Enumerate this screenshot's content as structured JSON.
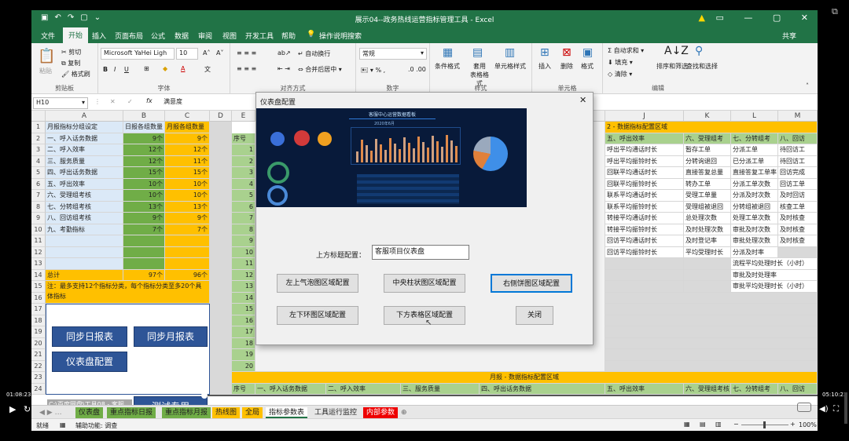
{
  "window": {
    "title": "展示04--政务热线运营指标管理工具 - Excel",
    "share": "共享"
  },
  "menu": {
    "items": [
      "文件",
      "开始",
      "插入",
      "页面布局",
      "公式",
      "数据",
      "审阅",
      "视图",
      "开发工具",
      "帮助"
    ],
    "active": "开始",
    "search": "操作说明搜索"
  },
  "ribbon": {
    "clipboard": {
      "label": "剪贴板",
      "paste": "粘贴",
      "cut": "剪切",
      "copy": "复制",
      "format_painter": "格式刷"
    },
    "font": {
      "label": "字体",
      "family": "Microsoft YaHei Ligh",
      "size": "10",
      "wen": "文"
    },
    "alignment": {
      "label": "对齐方式",
      "wrap": "自动换行",
      "merge": "合并后居中"
    },
    "number": {
      "label": "数字",
      "format": "常规"
    },
    "styles": {
      "label": "样式",
      "conditional": "条件格式",
      "table": "套用\n表格格式",
      "cell_styles": "单元格样式"
    },
    "cells": {
      "label": "单元格",
      "insert": "插入",
      "delete": "删除",
      "format": "格式"
    },
    "editing": {
      "label": "编辑",
      "autosum": "自动求和",
      "fill": "填充",
      "clear": "清除",
      "sort": "排序和筛选",
      "find": "查找和选择"
    }
  },
  "formula_bar": {
    "name_box": "H10",
    "content": "满意度"
  },
  "columns": [
    "A",
    "B",
    "C",
    "D",
    "E",
    "J",
    "K",
    "L",
    "M"
  ],
  "left_table": {
    "headers": [
      "月报指标分组设定",
      "日报各组数量",
      "月报各组数量"
    ],
    "rows": [
      [
        "一、呼入话务数据",
        "9个",
        "9个"
      ],
      [
        "二、呼入效率",
        "12个",
        "12个"
      ],
      [
        "三、服务质量",
        "12个",
        "11个"
      ],
      [
        "四、呼出话务数据",
        "15个",
        "15个"
      ],
      [
        "五、呼出效率",
        "10个",
        "10个"
      ],
      [
        "六、受理组考核",
        "10个",
        "10个"
      ],
      [
        "七、分转组考核",
        "13个",
        "13个"
      ],
      [
        "八、回访组考核",
        "9个",
        "9个"
      ],
      [
        "九、考勤指标",
        "7个",
        "7个"
      ]
    ],
    "total": [
      "总计",
      "97个",
      "96个"
    ],
    "note": "注：最多支持12个指标分类，每个指标分类至多20个具体指标"
  },
  "macro_buttons": {
    "sync_daily": "同步日报表",
    "sync_monthly": "同步月报表",
    "dashboard": "仪表盘配置",
    "test": "测试专用"
  },
  "e_column": {
    "header": "序号",
    "numbers": [
      "1",
      "2",
      "3",
      "4",
      "5",
      "6",
      "7",
      "8",
      "9",
      "10",
      "11",
      "12",
      "13",
      "14",
      "15",
      "16",
      "17",
      "18",
      "19",
      "20"
    ]
  },
  "right_area": {
    "title": "2 - 数据指标配置区域",
    "headers": [
      "五、呼出效率",
      "六、受理组考",
      "七、分转组考",
      "八、回访"
    ],
    "col_j": [
      "呼出平均通话时长",
      "呼出平均振铃时长",
      "回联平均通话时长",
      "回联平均振铃时长",
      "联系平均通话时长",
      "联系平均振铃时长",
      "转接平均通话时长",
      "转接平均振铃时长",
      "回访平均通话时长",
      "回访平均振铃时长"
    ],
    "col_k": [
      "暂存工单",
      "分转询退回",
      "直接答复总量",
      "转办工单",
      "受理工单量",
      "受理组被退回",
      "总处理次数",
      "及时处理次数",
      "及时登记率",
      "平均受理时长"
    ],
    "col_l": [
      "分派工单",
      "已分派工单",
      "直接答复工单率",
      "分派工单次数",
      "分派及时次数",
      "分转组被退回",
      "处理工单次数",
      "审批及时次数",
      "审批处理次数",
      "分派及时率",
      "流程平均处理时长（小时）",
      "审批及时处理率",
      "审批平均处理时长（小时）"
    ],
    "col_m": [
      "待回访工",
      "待回访工",
      "回访完成",
      "回访工单",
      "及时回访",
      "核查工单",
      "及时核查",
      "及时核查",
      "及时核查"
    ]
  },
  "bottom_area": {
    "title": "月报 - 数据指标配置区域",
    "headers": [
      "序号",
      "一、呼入话务数据",
      "二、呼入效率",
      "三、服务质量",
      "四、呼出话务数据",
      "五、呼出效率",
      "六、受理组考核",
      "七、分转组考",
      "八、回访"
    ]
  },
  "dialog": {
    "title": "仪表盘配置",
    "preview_title": "客服中心运营数据看板",
    "preview_date": "2020年6月",
    "field_label": "上方标题配置：",
    "field_value": "客服项目仪表盘",
    "buttons": {
      "upper_left": "左上气泡图区域配置",
      "center_bar": "中央柱状图区域配置",
      "right_pie": "右侧饼图区域配置",
      "lower_left": "左下环图区域配置",
      "bottom_table": "下方表格区域配置",
      "close": "关闭"
    }
  },
  "sheet_tabs": [
    "仪表盘",
    "重点指标日报",
    "重点指标月报",
    "热线图",
    "全局",
    "指标参数表",
    "工具运行监控",
    "内部参数"
  ],
  "status": {
    "ready": "就绪",
    "accessibility": "辅助功能: 调查",
    "zoom": "100%"
  },
  "player": {
    "current_time": "01:08:23",
    "total_time": "05:10:23",
    "overlay": "C:\\百度网盘\\工具08 - 客服"
  },
  "colors": {
    "excel_green": "#217346",
    "cell_green": "#70ad47",
    "cell_orange": "#ffc000",
    "cell_blue": "#dbe9f7",
    "macro_blue": "#2e5597"
  }
}
